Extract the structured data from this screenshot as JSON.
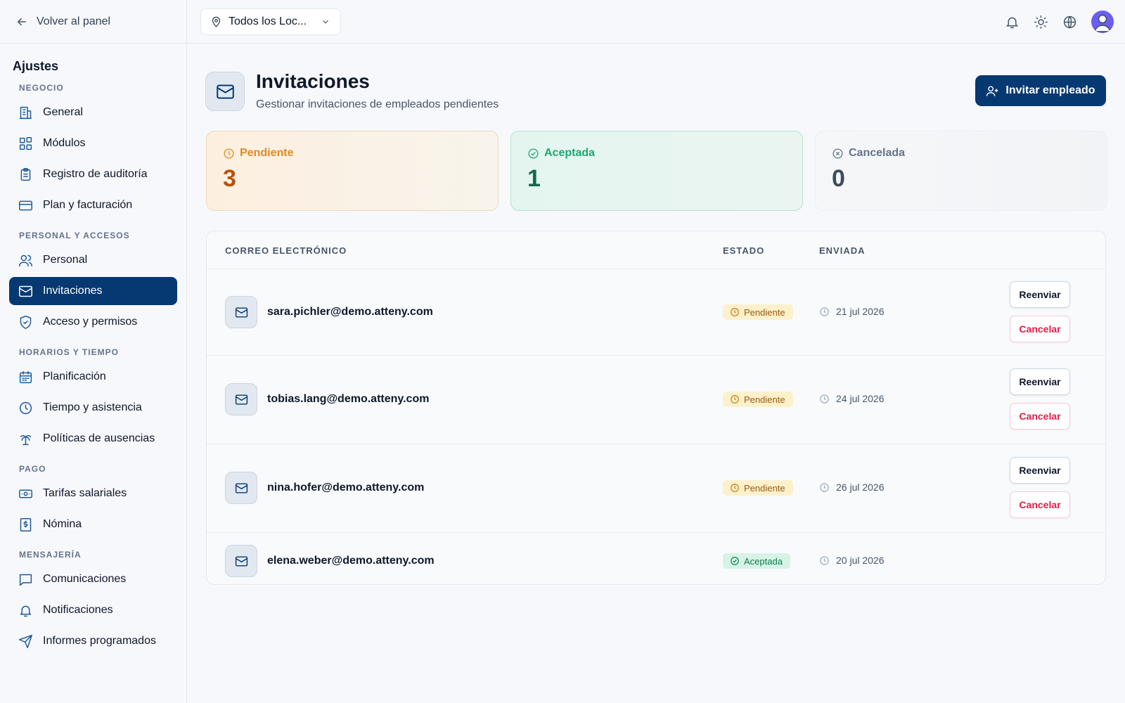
{
  "nav_back": "Volver al panel",
  "sidebar": {
    "title": "Ajustes",
    "sections": [
      {
        "label": "NEGOCIO",
        "items": [
          {
            "label": "General",
            "icon": "building-icon"
          },
          {
            "label": "Módulos",
            "icon": "modules-icon"
          },
          {
            "label": "Registro de auditoría",
            "icon": "clipboard-icon"
          },
          {
            "label": "Plan y facturación",
            "icon": "credit-card-icon"
          }
        ]
      },
      {
        "label": "PERSONAL Y ACCESOS",
        "items": [
          {
            "label": "Personal",
            "icon": "users-icon"
          },
          {
            "label": "Invitaciones",
            "icon": "mail-icon",
            "active": true
          },
          {
            "label": "Acceso y permisos",
            "icon": "shield-icon"
          }
        ]
      },
      {
        "label": "HORARIOS Y TIEMPO",
        "items": [
          {
            "label": "Planificación",
            "icon": "calendar-icon"
          },
          {
            "label": "Tiempo y asistencia",
            "icon": "clock-icon"
          },
          {
            "label": "Políticas de ausencias",
            "icon": "palm-tree-icon"
          }
        ]
      },
      {
        "label": "PAGO",
        "items": [
          {
            "label": "Tarifas salariales",
            "icon": "banknote-icon"
          },
          {
            "label": "Nómina",
            "icon": "receipt-icon"
          }
        ]
      },
      {
        "label": "MENSAJERÍA",
        "items": [
          {
            "label": "Comunicaciones",
            "icon": "message-icon"
          },
          {
            "label": "Notificaciones",
            "icon": "bell-icon"
          },
          {
            "label": "Informes programados",
            "icon": "send-icon"
          }
        ]
      }
    ]
  },
  "topbar": {
    "location_label": "Todos los Loc...",
    "icons": [
      "bell-icon",
      "sun-icon",
      "globe-icon",
      "avatar"
    ]
  },
  "page": {
    "title": "Invitaciones",
    "subtitle": "Gestionar invitaciones de empleados pendientes",
    "invite_label": "Invitar empleado"
  },
  "stats": {
    "pending": {
      "label": "Pendiente",
      "value": "3"
    },
    "accepted": {
      "label": "Aceptada",
      "value": "1"
    },
    "cancelled": {
      "label": "Cancelada",
      "value": "0"
    }
  },
  "table": {
    "headers": {
      "email": "CORREO ELECTRÓNICO",
      "status": "ESTADO",
      "sent": "ENVIADA"
    },
    "resend_label": "Reenviar",
    "cancel_label": "Cancelar",
    "rows": [
      {
        "email": "sara.pichler@demo.atteny.com",
        "status": "Pendiente",
        "sent": "21 jul 2026"
      },
      {
        "email": "tobias.lang@demo.atteny.com",
        "status": "Pendiente",
        "sent": "24 jul 2026"
      },
      {
        "email": "nina.hofer@demo.atteny.com",
        "status": "Pendiente",
        "sent": "26 jul 2026"
      },
      {
        "email": "elena.weber@demo.atteny.com",
        "status": "Aceptada",
        "sent": "20 jul 2026"
      }
    ]
  },
  "colors": {
    "brand": "#063972",
    "pending": "#e38a22",
    "accepted": "#1ea672",
    "cancel": "#e11d48"
  }
}
